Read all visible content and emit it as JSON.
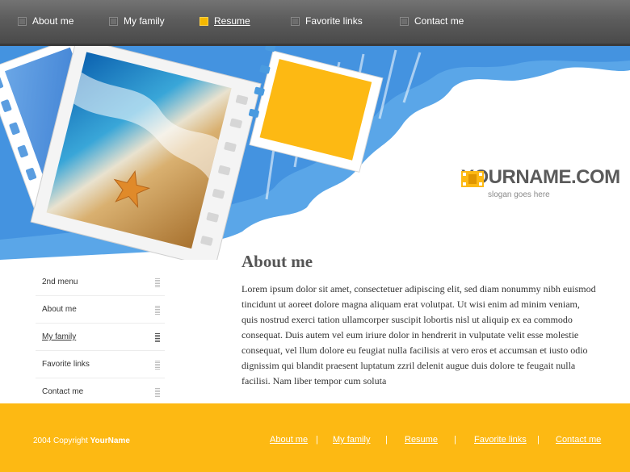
{
  "topnav": {
    "items": [
      {
        "label": "About me",
        "active": false
      },
      {
        "label": "My family",
        "active": false
      },
      {
        "label": "Resume",
        "active": true
      },
      {
        "label": "Favorite links",
        "active": false
      },
      {
        "label": "Contact me",
        "active": false
      }
    ]
  },
  "header": {
    "logo_name": "YOURNAME.COM",
    "slogan": "slogan goes here"
  },
  "sidemenu": {
    "items": [
      {
        "label": "2nd menu"
      },
      {
        "label": "About me"
      },
      {
        "label": "My family",
        "active": true
      },
      {
        "label": "Favorite links"
      },
      {
        "label": "Contact me"
      }
    ]
  },
  "main": {
    "title": "About me",
    "body": "Lorem ipsum dolor sit amet, consectetuer adipiscing elit, sed diam nonummy nibh euismod tincidunt ut aoreet dolore magna aliquam erat volutpat. Ut wisi enim ad minim veniam, quis nostrud exerci tation ullamcorper suscipit lobortis nisl ut aliquip ex ea commodo consequat. Duis autem vel eum iriure dolor in hendrerit in vulputate velit esse molestie consequat, vel llum dolore eu feugiat nulla facilisis at vero eros et accumsan et iusto odio dignissim qui blandit praesent luptatum zzril delenit augue duis dolore te feugait nulla facilisi. Nam liber tempor cum soluta"
  },
  "footer": {
    "copyright_prefix": "2004 Copyright",
    "copyright_name": "YourName",
    "links": [
      "About me",
      "My family",
      "Resume",
      "Favorite links",
      "Contact me"
    ],
    "separator": "|"
  },
  "colors": {
    "accent_yellow": "#fdb913",
    "sky_blue": "#4a9be0",
    "nav_gray": "#5c5c5c"
  }
}
